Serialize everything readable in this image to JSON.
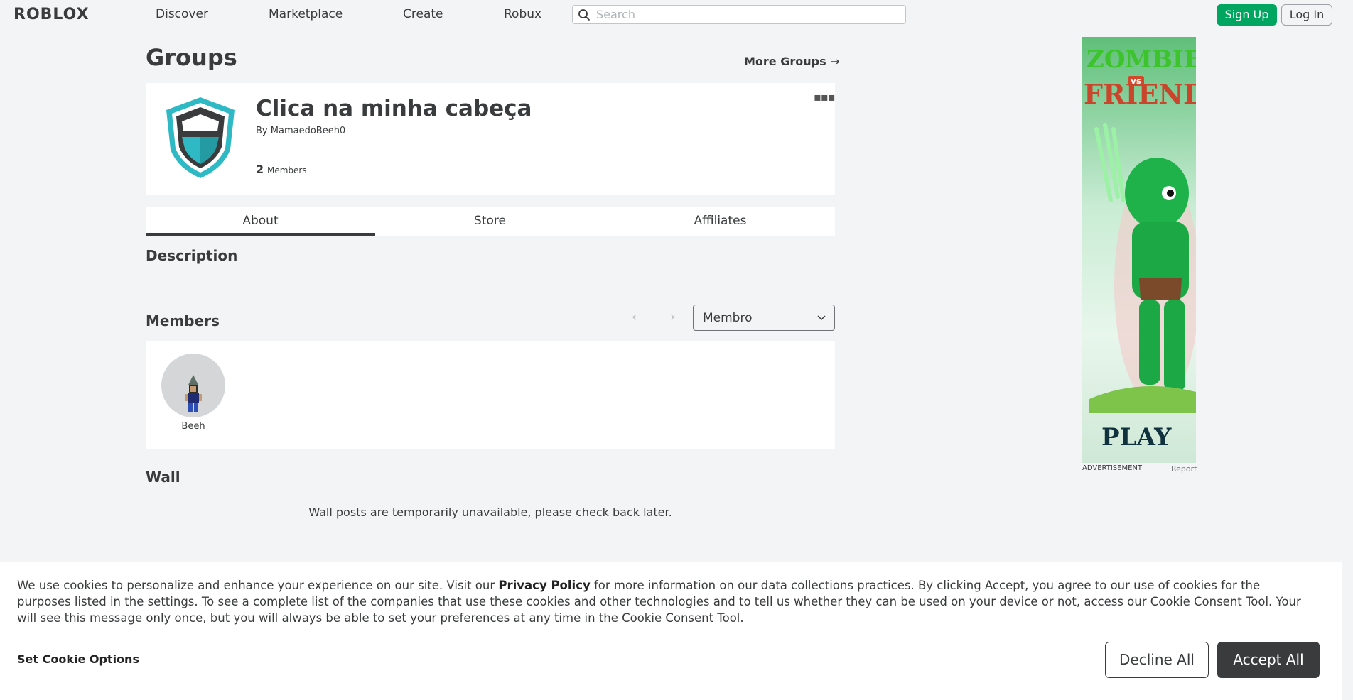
{
  "nav": {
    "logo": "ROBLOX",
    "links": [
      "Discover",
      "Marketplace",
      "Create",
      "Robux"
    ],
    "search_placeholder": "Search",
    "signup_label": "Sign Up",
    "login_label": "Log In"
  },
  "page": {
    "title": "Groups",
    "more_groups_label": "More Groups",
    "more_groups_arrow": "→"
  },
  "group": {
    "name": "Clica na minha cabeça",
    "by_prefix": "By",
    "owner": "MamaedoBeeh0",
    "member_count": "2",
    "member_label": "Members",
    "menu_dots": "▪▪▪"
  },
  "tabs": [
    "About",
    "Store",
    "Affiliates"
  ],
  "description": {
    "title": "Description"
  },
  "members": {
    "title": "Members",
    "role_filter": "Membro",
    "prev_symbol": "‹",
    "next_symbol": "›",
    "list": [
      {
        "name": "Beeh"
      }
    ]
  },
  "wall": {
    "title": "Wall",
    "message": "Wall posts are temporarily unavailable, please check back later."
  },
  "ad": {
    "title_line1": "ZOMBIE",
    "title_vs": "vs",
    "title_line2": "FRIEND",
    "cta": "PLAY",
    "label": "ADVERTISEMENT",
    "report": "Report"
  },
  "cookie": {
    "text_before_link": "We use cookies to personalize and enhance your experience on our site. Visit our ",
    "link": "Privacy Policy",
    "text_after_link": " for more information on our data collections practices. By clicking Accept, you agree to our use of cookies for the purposes listed in the settings. To see a complete list of the companies that use these cookies and other technologies and to tell us whether they can be used on your device or not, access our Cookie Consent Tool. Your will see this message only once, but you will always be able to set your preferences at any time in the Cookie Consent Tool.",
    "set_options": "Set Cookie Options",
    "decline": "Decline All",
    "accept": "Accept All"
  },
  "colors": {
    "accent_green": "#00a55f",
    "text_dark": "#393b3d",
    "background": "#f2f4f5",
    "shield_teal": "#2fb9c4"
  }
}
